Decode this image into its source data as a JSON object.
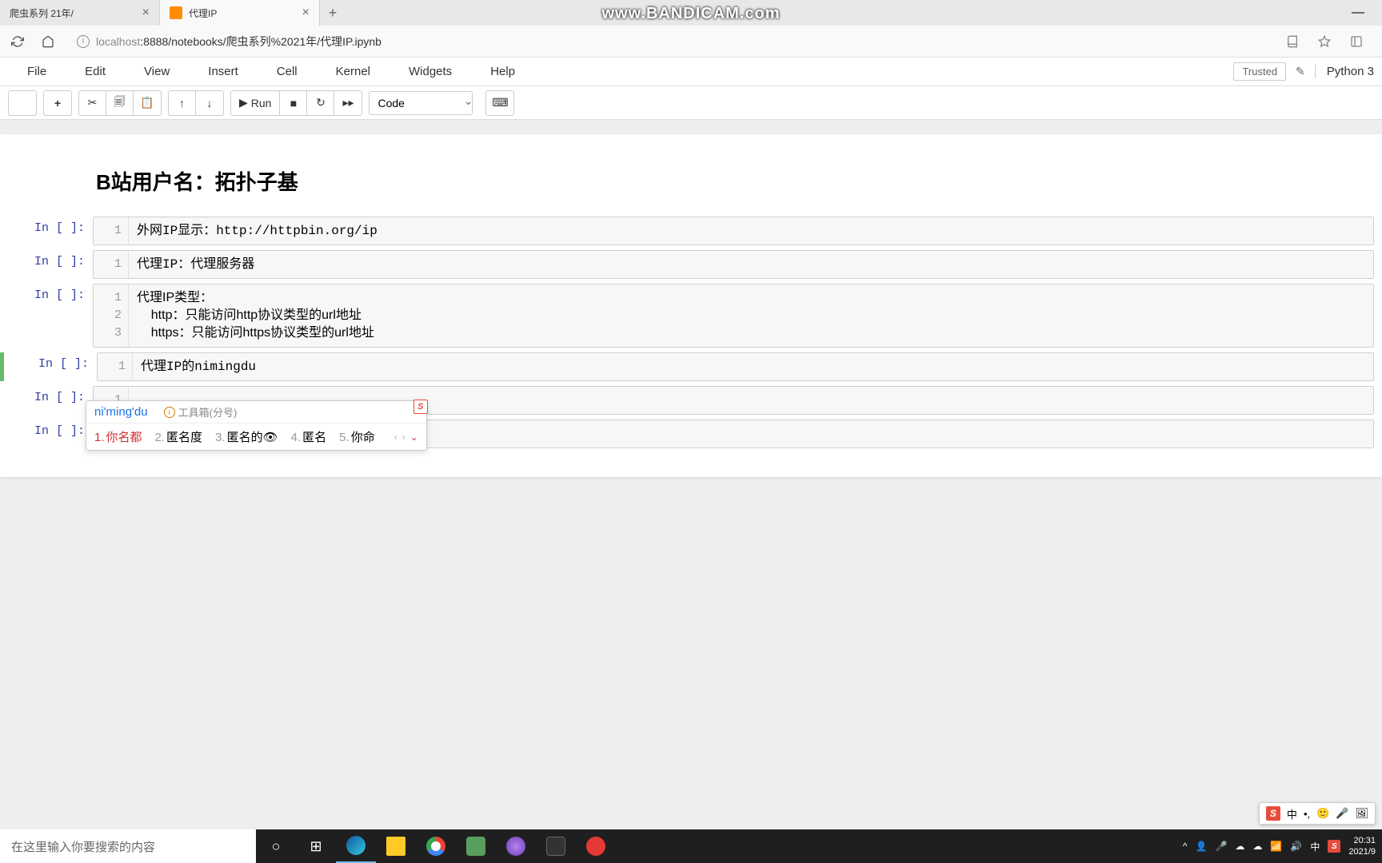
{
  "browser": {
    "tabs": [
      {
        "title": "爬虫系列 21年/",
        "active": false
      },
      {
        "title": "代理IP",
        "active": true
      }
    ],
    "watermark": "www.BANDICAM.com",
    "url_host": "localhost",
    "url_path": ":8888/notebooks/爬虫系列%2021年/代理IP.ipynb"
  },
  "jupyter": {
    "menu": [
      "File",
      "Edit",
      "View",
      "Insert",
      "Cell",
      "Kernel",
      "Widgets",
      "Help"
    ],
    "trusted": "Trusted",
    "kernel": "Python 3",
    "run_label": "Run",
    "cell_type": "Code"
  },
  "notebook": {
    "heading": "B站用户名：拓扑子基",
    "cells": [
      {
        "prompt": "In [ ]:",
        "lines": [
          "外网IP显示：http://httpbin.org/ip"
        ]
      },
      {
        "prompt": "In [ ]:",
        "lines": [
          "代理IP：代理服务器"
        ]
      },
      {
        "prompt": "In [ ]:",
        "lines": [
          "代理IP类型：",
          "    http：只能访问http协议类型的url地址",
          "    https：只能访问https协议类型的url地址"
        ]
      },
      {
        "prompt": "In [ ]:",
        "lines": [
          "代理IP的nimingdu"
        ],
        "selected": true
      },
      {
        "prompt": "In [ ]:",
        "lines": [
          ""
        ]
      },
      {
        "prompt": "In [ ]:",
        "lines": [
          ""
        ]
      }
    ]
  },
  "ime": {
    "pinyin": "ni'ming'du",
    "toolbox": "工具箱(分号)",
    "candidates": [
      {
        "n": "1.",
        "text": "你名都"
      },
      {
        "n": "2.",
        "text": "匿名度"
      },
      {
        "n": "3.",
        "text": "匿名的"
      },
      {
        "n": "4.",
        "text": "匿名"
      },
      {
        "n": "5.",
        "text": "你命"
      }
    ]
  },
  "ime_status": {
    "items": [
      "中",
      "•,",
      "🙂",
      "🎤",
      "🖼"
    ]
  },
  "taskbar": {
    "search_placeholder": "在这里输入你要搜索的内容",
    "time": "20:31",
    "date": "2021/9"
  }
}
